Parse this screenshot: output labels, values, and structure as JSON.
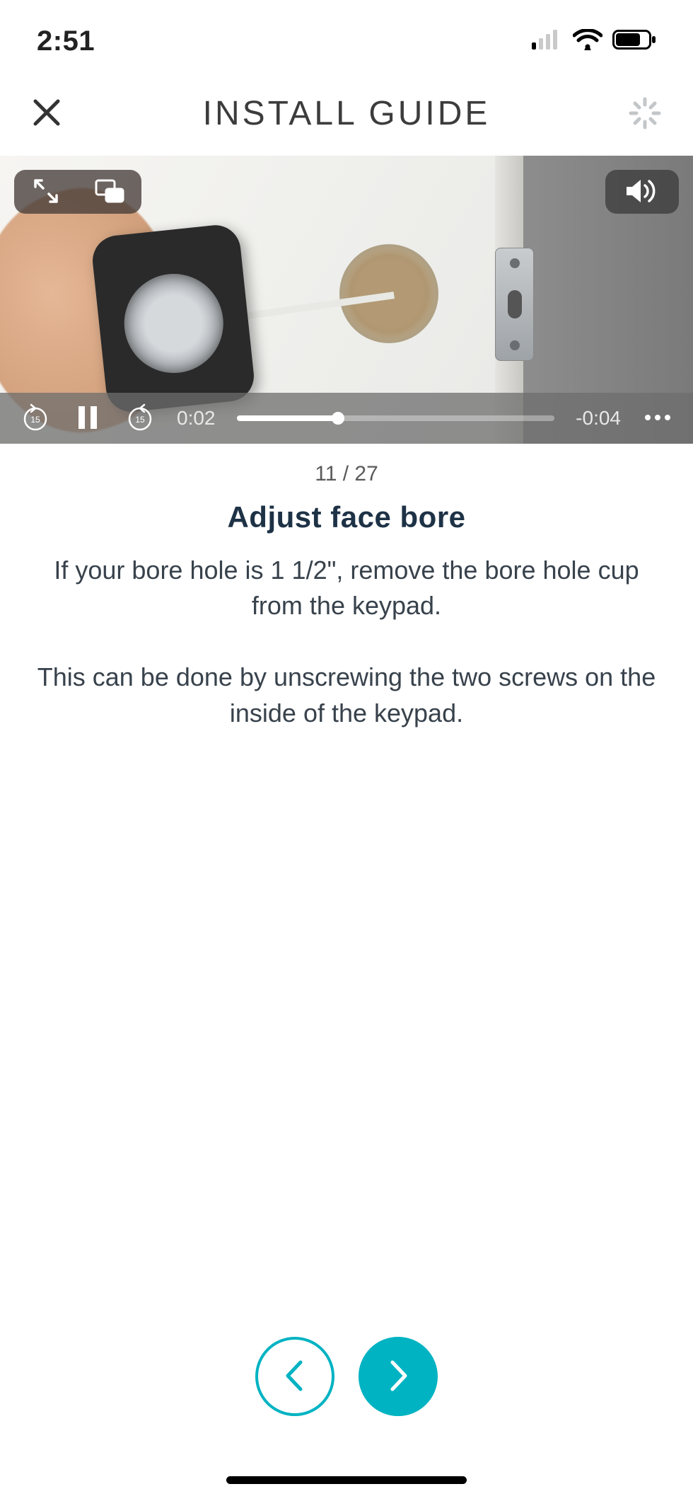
{
  "status_bar": {
    "time": "2:51"
  },
  "header": {
    "title": "INSTALL GUIDE"
  },
  "video": {
    "elapsed": "0:02",
    "remaining": "-0:04",
    "progress_pct": 32,
    "icons": {
      "fullscreen": "fullscreen-icon",
      "pip": "pip-icon",
      "volume": "volume-icon",
      "rewind15": "rewind-15-icon",
      "pause": "pause-icon",
      "forward15": "forward-15-icon",
      "more": "more-icon"
    }
  },
  "step": {
    "counter": "11 / 27",
    "title": "Adjust face bore",
    "body": "If your bore hole is 1 1/2\", remove the bore hole cup from the keypad.\n\nThis can be done by unscrewing the two screws on the inside of the keypad."
  },
  "pager": {
    "prev": "previous-step",
    "next": "next-step"
  },
  "colors": {
    "accent": "#00b3c2"
  }
}
